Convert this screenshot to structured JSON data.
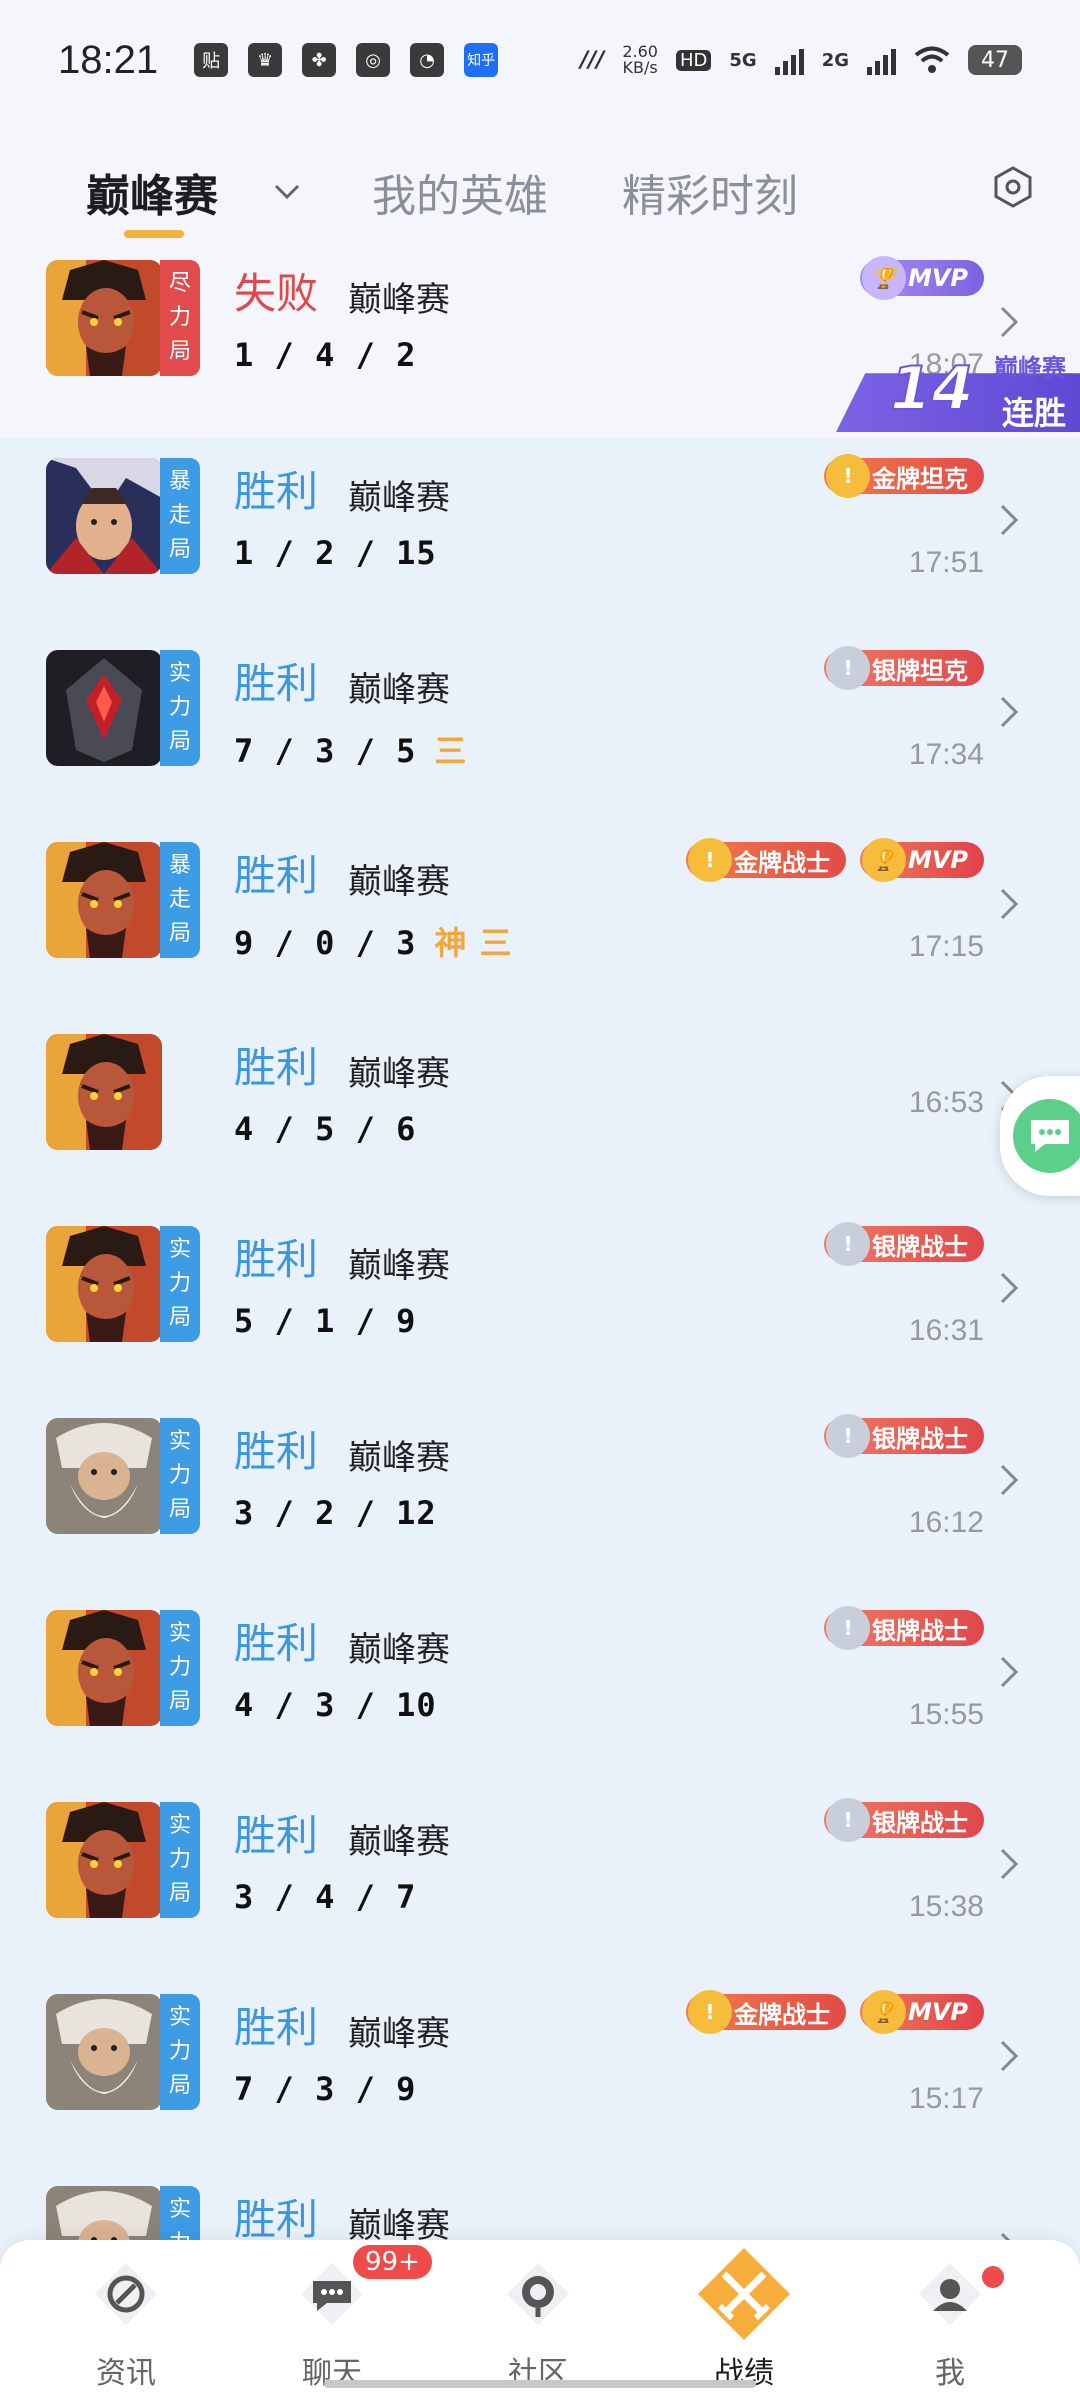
{
  "status": {
    "time": "18:21",
    "speed": "2.60",
    "speed_unit": "KB/s",
    "hd": "HD",
    "net1": "5G",
    "net2": "2G",
    "battery": "47"
  },
  "tabs": [
    {
      "label": "巅峰赛"
    },
    {
      "label": "我的英雄"
    },
    {
      "label": "精彩时刻"
    }
  ],
  "matches": [
    {
      "result": "失败",
      "outcome": "lose",
      "mode": "巅峰赛",
      "kda": "1 / 4 / 2",
      "badge": [
        "尽",
        "力",
        "局"
      ],
      "badge_color": "red",
      "time": "18:07",
      "honors": [
        {
          "label": "MVP",
          "kind": "mvp-purple"
        }
      ],
      "hero": "red",
      "streak": {
        "num": "14",
        "top": "巅峰赛",
        "bottom": "连胜"
      }
    },
    {
      "result": "胜利",
      "outcome": "win",
      "mode": "巅峰赛",
      "kda": "1 / 2 / 15",
      "badge": [
        "暴",
        "走",
        "局"
      ],
      "badge_color": "blue",
      "time": "17:51",
      "honors": [
        {
          "label": "金牌坦克",
          "kind": "gold"
        }
      ],
      "hero": "fighter"
    },
    {
      "result": "胜利",
      "outcome": "win",
      "mode": "巅峰赛",
      "kda": "7 / 3 / 5",
      "extra": "三",
      "badge": [
        "实",
        "力",
        "局"
      ],
      "badge_color": "blue",
      "time": "17:34",
      "honors": [
        {
          "label": "银牌坦克",
          "kind": "silver"
        }
      ],
      "hero": "armor"
    },
    {
      "result": "胜利",
      "outcome": "win",
      "mode": "巅峰赛",
      "kda": "9 / 0 / 3",
      "extra": "神 三",
      "badge": [
        "暴",
        "走",
        "局"
      ],
      "badge_color": "blue",
      "time": "17:15",
      "honors": [
        {
          "label": "金牌战士",
          "kind": "gold"
        },
        {
          "label": "MVP",
          "kind": "mvp-red"
        }
      ],
      "hero": "red"
    },
    {
      "result": "胜利",
      "outcome": "win",
      "mode": "巅峰赛",
      "kda": "4 / 5 / 6",
      "badge": [],
      "badge_color": "none",
      "time": "16:53",
      "honors": [],
      "hero": "red"
    },
    {
      "result": "胜利",
      "outcome": "win",
      "mode": "巅峰赛",
      "kda": "5 / 1 / 9",
      "badge": [
        "实",
        "力",
        "局"
      ],
      "badge_color": "blue",
      "time": "16:31",
      "honors": [
        {
          "label": "银牌战士",
          "kind": "silver"
        }
      ],
      "hero": "red"
    },
    {
      "result": "胜利",
      "outcome": "win",
      "mode": "巅峰赛",
      "kda": "3 / 2 / 12",
      "badge": [
        "实",
        "力",
        "局"
      ],
      "badge_color": "blue",
      "time": "16:12",
      "honors": [
        {
          "label": "银牌战士",
          "kind": "silver"
        }
      ],
      "hero": "elder"
    },
    {
      "result": "胜利",
      "outcome": "win",
      "mode": "巅峰赛",
      "kda": "4 / 3 / 10",
      "badge": [
        "实",
        "力",
        "局"
      ],
      "badge_color": "blue",
      "time": "15:55",
      "honors": [
        {
          "label": "银牌战士",
          "kind": "silver"
        }
      ],
      "hero": "red"
    },
    {
      "result": "胜利",
      "outcome": "win",
      "mode": "巅峰赛",
      "kda": "3 / 4 / 7",
      "badge": [
        "实",
        "力",
        "局"
      ],
      "badge_color": "blue",
      "time": "15:38",
      "honors": [
        {
          "label": "银牌战士",
          "kind": "silver"
        }
      ],
      "hero": "red"
    },
    {
      "result": "胜利",
      "outcome": "win",
      "mode": "巅峰赛",
      "kda": "7 / 3 / 9",
      "badge": [
        "实",
        "力",
        "局"
      ],
      "badge_color": "blue",
      "time": "15:17",
      "honors": [
        {
          "label": "金牌战士",
          "kind": "gold"
        },
        {
          "label": "MVP",
          "kind": "mvp-red"
        }
      ],
      "hero": "elder"
    },
    {
      "result": "胜利",
      "outcome": "win",
      "mode": "巅峰赛",
      "kda": "",
      "badge": [
        "实",
        "力",
        "局"
      ],
      "badge_color": "blue",
      "time": "",
      "honors": [],
      "hero": "elder"
    }
  ],
  "nav": [
    {
      "label": "资讯",
      "icon": "compass-icon"
    },
    {
      "label": "聊天",
      "icon": "chat-icon",
      "badge": "99+"
    },
    {
      "label": "社区",
      "icon": "community-icon"
    },
    {
      "label": "战绩",
      "icon": "swords-icon",
      "active": true
    },
    {
      "label": "我",
      "icon": "profile-icon",
      "dot": true
    }
  ],
  "colors": {
    "win": "#3c97e3",
    "lose": "#e2474a",
    "accent": "#f3b33d",
    "bg": "#e9f1fb"
  }
}
